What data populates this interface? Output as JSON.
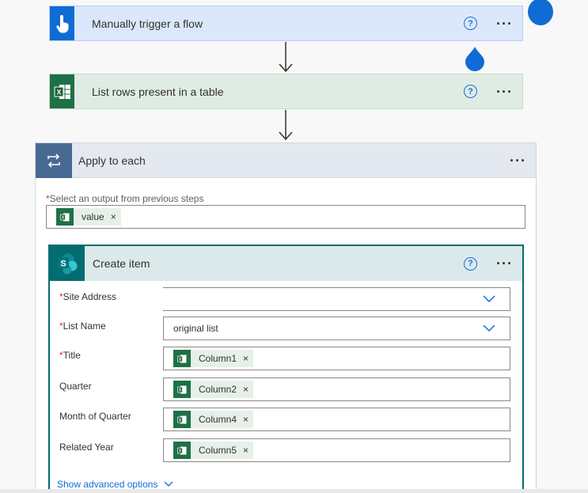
{
  "trigger_card": {
    "title": "Manually trigger a flow",
    "help": "?",
    "more": "···"
  },
  "excel_card": {
    "title": "List rows present in a table",
    "help": "?",
    "more": "···"
  },
  "apply_each": {
    "title": "Apply to each",
    "more": "···",
    "output_label": "Select an output from previous steps",
    "required_mark": "*",
    "output_token": "value",
    "token_remove": "×"
  },
  "create_item": {
    "title": "Create item",
    "help": "?",
    "more": "···",
    "fields": [
      {
        "label": "Site Address",
        "required": "*",
        "value": ""
      },
      {
        "label": "List Name",
        "required": "*",
        "value": "original list"
      },
      {
        "label": "Title",
        "required": "*",
        "token": "Column1"
      },
      {
        "label": "Quarter",
        "required": "",
        "token": "Column2"
      },
      {
        "label": "Month of Quarter",
        "required": "",
        "token": "Column4"
      },
      {
        "label": "Related Year",
        "required": "",
        "token": "Column5"
      }
    ],
    "token_remove": "×",
    "advanced_label": "Show advanced options"
  },
  "colors": {
    "trigger_blue": "#0f6cd4",
    "excel_green": "#1e7145",
    "apply_header": "#486991",
    "sharepoint_teal": "#036c70"
  },
  "icons": [
    "touch-trigger-icon",
    "excel-icon",
    "loop-icon",
    "sharepoint-icon",
    "help-icon",
    "chevron-down-icon",
    "close-icon"
  ]
}
